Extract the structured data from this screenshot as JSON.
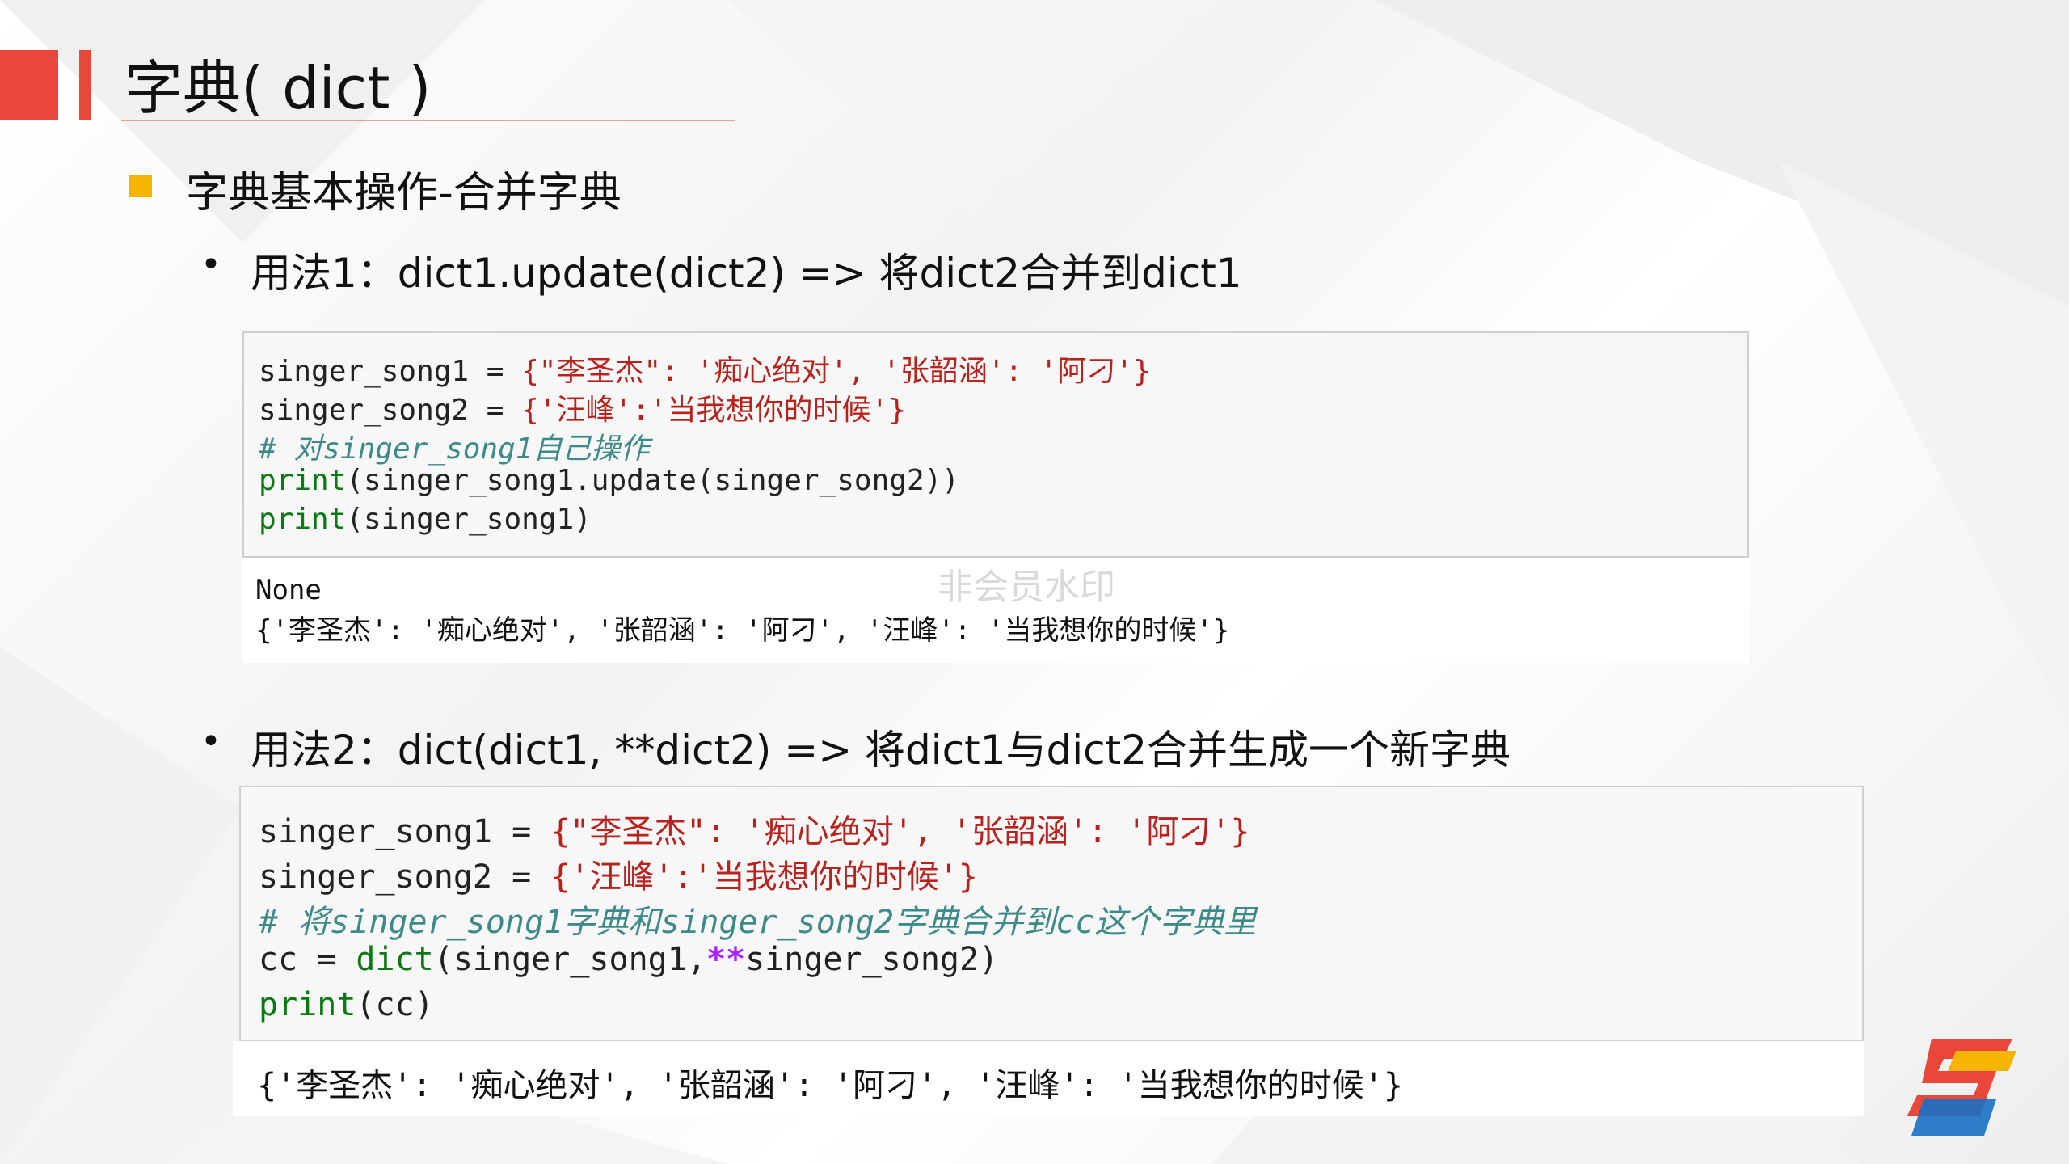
{
  "slide": {
    "title": "字典( dict )",
    "heading": "字典基本操作-合并字典",
    "watermark": "非会员水印"
  },
  "usage1": {
    "bullet": "•",
    "text": "用法1：dict1.update(dict2) => 将dict2合并到dict1",
    "code": {
      "l1_var": "singer_song1 = ",
      "l1_str": "{\"李圣杰\": '痴心绝对', '张韶涵': '阿刁'}",
      "l2_var": "singer_song2 = ",
      "l2_str": "{'汪峰':'当我想你的时候'}",
      "l3_comment": "# 对singer_song1自己操作",
      "l4_fn": "print",
      "l4_rest": "(singer_song1.update(singer_song2))",
      "l5_fn": "print",
      "l5_rest": "(singer_song1)"
    },
    "output": {
      "l1": "None",
      "l2": "{'李圣杰': '痴心绝对', '张韶涵': '阿刁', '汪峰': '当我想你的时候'}"
    }
  },
  "usage2": {
    "bullet": "•",
    "text": "用法2：dict(dict1, **dict2) => 将dict1与dict2合并生成一个新字典",
    "code": {
      "l1_var": "singer_song1 = ",
      "l1_str": "{\"李圣杰\": '痴心绝对', '张韶涵': '阿刁'}",
      "l2_var": "singer_song2 = ",
      "l2_str": "{'汪峰':'当我想你的时候'}",
      "l3_comment": "# 将singer_song1字典和singer_song2字典合并到cc这个字典里",
      "l4_var": "cc = ",
      "l4_fn": "dict",
      "l4_a": "(singer_song1,",
      "l4_op": "**",
      "l4_b": "singer_song2)",
      "l5_fn": "print",
      "l5_rest": "(cc)"
    },
    "output": {
      "l1": "{'李圣杰': '痴心绝对', '张韶涵': '阿刁', '汪峰': '当我想你的时候'}"
    }
  },
  "colors": {
    "accent_red": "#e8473a",
    "bullet_yellow": "#f5b400",
    "string_red": "#b8211c",
    "comment_teal": "#3e8a8a",
    "builtin_green": "#0b7a12",
    "operator_purple": "#aa22ff"
  },
  "icons": {
    "logo": "brand-s-logo-icon"
  }
}
